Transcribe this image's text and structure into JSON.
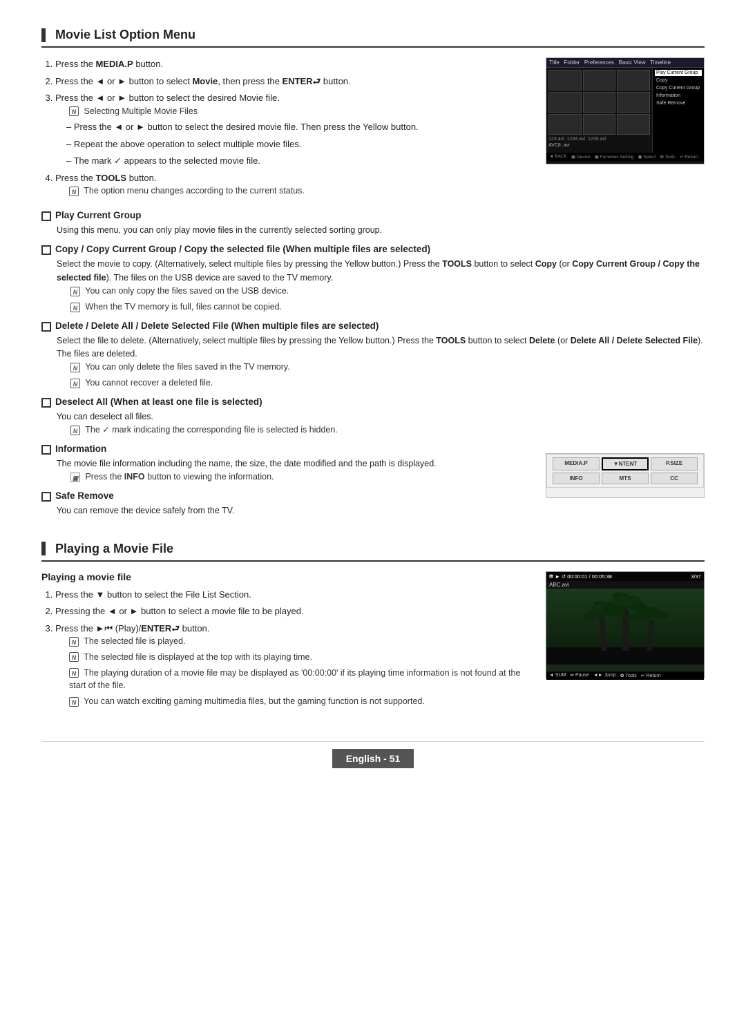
{
  "page": {
    "section1_title": "Movie List Option Menu",
    "section2_title": "Playing a Movie File",
    "footer_text": "English - 51"
  },
  "section1": {
    "steps": [
      {
        "num": "1.",
        "text": "Press the ",
        "bold": "MEDIA.P",
        "after": " button."
      },
      {
        "num": "2.",
        "text": "Press the ◄ or ► button to select ",
        "bold": "Movie",
        "after": ", then press the ",
        "bold2": "ENTER",
        "after2": " button."
      },
      {
        "num": "3.",
        "text": "Press the ◄ or ► button to select the desired Movie file."
      },
      {
        "num": "4.",
        "text": "Press the ",
        "bold": "TOOLS",
        "after": " button."
      }
    ],
    "note_selecting": "Selecting Multiple Movie Files",
    "sub_items": [
      "Press the ◄ or ► button to select the desired movie file. Then press the Yellow button.",
      "Repeat the above operation to select multiple movie files.",
      "The mark ✓ appears to the selected movie file."
    ],
    "note_tools": "The option menu changes according to the current status.",
    "play_current_group_title": "Play Current Group",
    "play_current_group_body": "Using this menu, you can only play movie files in the currently selected sorting group.",
    "copy_title": "Copy / Copy Current Group / Copy the selected file (When multiple files are selected)",
    "copy_body1": "Select the movie to copy. (Alternatively, select multiple files by pressing the Yellow button.) Press the ",
    "copy_bold1": "TOOLS",
    "copy_body2": " button to select ",
    "copy_bold2": "Copy",
    "copy_body3": " (or ",
    "copy_bold3": "Copy Current Group / Copy the selected file",
    "copy_body4": "). The files on the USB device are saved to the TV memory.",
    "copy_note1": "You can only copy the files saved on the USB device.",
    "copy_note2": "When the TV memory is full, files cannot be copied.",
    "delete_title": "Delete / Delete All / Delete Selected File (When multiple files are selected)",
    "delete_body1": "Select the file to delete. (Alternatively, select multiple files by pressing the Yellow button.) Press the ",
    "delete_bold1": "TOOLS",
    "delete_body2": " button to select ",
    "delete_bold2": "Delete",
    "delete_body3": " (or ",
    "delete_bold3": "Delete All / Delete Selected File",
    "delete_body4": "). The files are deleted.",
    "delete_note1": "You can only delete the files saved in the TV memory.",
    "delete_note2": "You cannot recover a deleted file.",
    "deselect_title": "Deselect All (When at least one file is selected)",
    "deselect_body": "You can deselect all files.",
    "deselect_note": "The ✓ mark indicating the corresponding file is selected is hidden.",
    "info_title": "Information",
    "info_body": "The movie file information including the name, the size, the date modified and the path is displayed.",
    "info_note": "Press the ",
    "info_bold": "INFO",
    "info_note_after": " button to viewing the information.",
    "safe_title": "Safe Remove",
    "safe_body": "You can remove the device safely from the TV.",
    "info_buttons": [
      "MEDIA.P",
      "NTENT",
      "P.SIZE",
      "INFO",
      "MTS",
      "CC"
    ]
  },
  "section2": {
    "subtitle": "Playing a movie file",
    "steps": [
      {
        "num": "1.",
        "text": "Press the ▼ button to select the File List Section."
      },
      {
        "num": "2.",
        "text": "Pressing the ◄ or ► button to select a movie file to be played."
      },
      {
        "num": "3.",
        "text": "Press the ►| (Play)/ENTER  button."
      }
    ],
    "note1": "The selected file is played.",
    "note2": "The selected file is displayed at the top with its playing time.",
    "note3": "The playing duration of a movie file may be displayed as '00:00:00' if its playing time information is not found at the start of the file.",
    "note4": "You can watch exciting gaming multimedia files, but the gaming function is not supported.",
    "player_time": "00:00:01 / 00:05:38",
    "player_track": "3/37",
    "player_filename": "ABC.avi",
    "player_bottom": "◄ SUM    ▐▐ Pause   ◄► Jump   ✿ Tools   ↩ Return"
  }
}
